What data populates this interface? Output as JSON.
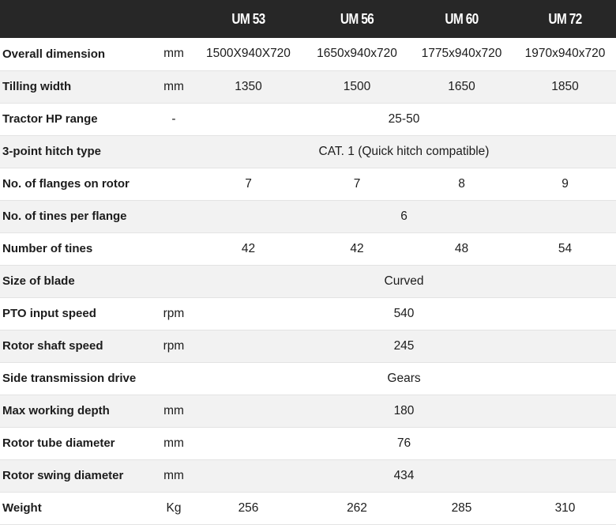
{
  "header": {
    "models": [
      "UM 53",
      "UM 56",
      "UM 60",
      "UM 72"
    ]
  },
  "rows": [
    {
      "param": "Overall dimension",
      "unit": "mm",
      "values": [
        "1500X940X720",
        "1650x940x720",
        "1775x940x720",
        "1970x940x720"
      ]
    },
    {
      "param": "Tilling width",
      "unit": "mm",
      "values": [
        "1350",
        "1500",
        "1650",
        "1850"
      ]
    },
    {
      "param": "Tractor HP range",
      "unit": "-",
      "common": "25-50"
    },
    {
      "param": "3-point hitch type",
      "unit": "",
      "common": "CAT. 1 (Quick hitch compatible)"
    },
    {
      "param": "No. of flanges on rotor",
      "unit": "",
      "values": [
        "7",
        "7",
        "8",
        "9"
      ]
    },
    {
      "param": "No. of tines per flange",
      "unit": "",
      "common": "6"
    },
    {
      "param": "Number of tines",
      "unit": "",
      "values": [
        "42",
        "42",
        "48",
        "54"
      ]
    },
    {
      "param": "Size of blade",
      "unit": "",
      "common": "Curved"
    },
    {
      "param": "PTO input speed",
      "unit": "rpm",
      "common": "540"
    },
    {
      "param": "Rotor shaft speed",
      "unit": "rpm",
      "common": "245"
    },
    {
      "param": "Side transmission drive",
      "unit": "",
      "common": "Gears"
    },
    {
      "param": "Max working depth",
      "unit": "mm",
      "common": "180"
    },
    {
      "param": "Rotor tube diameter",
      "unit": "mm",
      "common": "76"
    },
    {
      "param": "Rotor swing diameter",
      "unit": "mm",
      "common": "434"
    },
    {
      "param": "Weight",
      "unit": "Kg",
      "values": [
        "256",
        "262",
        "285",
        "310"
      ]
    }
  ]
}
